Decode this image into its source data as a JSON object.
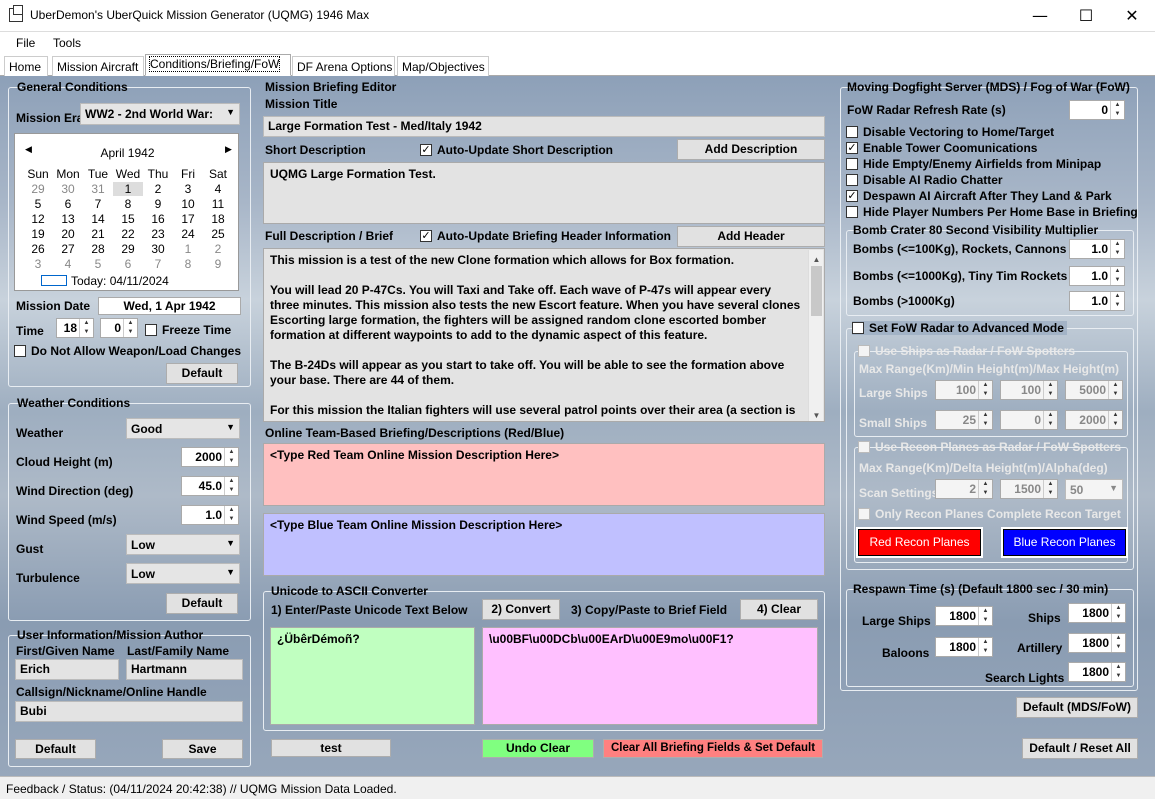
{
  "window": {
    "title": "UberDemon's UberQuick Mission Generator (UQMG) 1946 Max",
    "minimize": "—",
    "maximize": "☐",
    "close": "✕"
  },
  "menu": [
    "File",
    "Tools"
  ],
  "tabs": [
    "Home",
    "Mission Aircraft",
    "Conditions/Briefing/FoW",
    "DF Arena Options",
    "Map/Objectives"
  ],
  "general": {
    "title": "General Conditions",
    "era_label": "Mission Era",
    "era_value": "WW2 - 2nd World War:",
    "calendar": {
      "month": "April 1942",
      "days": [
        "Sun",
        "Mon",
        "Tue",
        "Wed",
        "Thu",
        "Fri",
        "Sat"
      ],
      "weeks": [
        [
          "29",
          "30",
          "31",
          "1",
          "2",
          "3",
          "4"
        ],
        [
          "5",
          "6",
          "7",
          "8",
          "9",
          "10",
          "11"
        ],
        [
          "12",
          "13",
          "14",
          "15",
          "16",
          "17",
          "18"
        ],
        [
          "19",
          "20",
          "21",
          "22",
          "23",
          "24",
          "25"
        ],
        [
          "26",
          "27",
          "28",
          "29",
          "30",
          "1",
          "2"
        ],
        [
          "3",
          "4",
          "5",
          "6",
          "7",
          "8",
          "9"
        ]
      ],
      "today": "Today: 04/11/2024"
    },
    "date_label": "Mission Date",
    "date_value": "Wed, 1 Apr 1942",
    "time_label": "Time",
    "hour": "18",
    "minute": "0",
    "freeze": "Freeze Time",
    "noweapon": "Do Not Allow Weapon/Load Changes",
    "default_btn": "Default"
  },
  "weather": {
    "title": "Weather Conditions",
    "weather_label": "Weather",
    "weather_value": "Good",
    "cloud_label": "Cloud Height (m)",
    "cloud_value": "2000",
    "wdir_label": "Wind Direction (deg)",
    "wdir_value": "45.0",
    "wspd_label": "Wind Speed (m/s)",
    "wspd_value": "1.0",
    "gust_label": "Gust",
    "gust_value": "Low",
    "turb_label": "Turbulence",
    "turb_value": "Low",
    "default_btn": "Default"
  },
  "user": {
    "title": "User Information/Mission Author",
    "first_label": "First/Given Name",
    "first_value": "Erich",
    "last_label": "Last/Family Name",
    "last_value": "Hartmann",
    "callsign_label": "Callsign/Nickname/Online Handle",
    "callsign_value": "Bubi",
    "default_btn": "Default",
    "save_btn": "Save"
  },
  "briefing": {
    "title": "Mission Briefing Editor",
    "mission_title_label": "Mission Title",
    "mission_title": "Large Formation Test - Med/Italy 1942",
    "short_label": "Short Description",
    "short_auto": "Auto-Update Short Description",
    "add_desc": "Add Description",
    "short_text": "UQMG Large Formation Test.",
    "full_label": "Full Description / Brief",
    "full_auto": "Auto-Update Briefing Header Information",
    "add_header": "Add Header",
    "full_p1": "This mission is a test of the new Clone formation which allows for Box formation.",
    "full_p2": "You will lead 20 P-47Cs.  You will Taxi and Take off.  Each wave of P-47s will appear every three minutes.  This mission also tests the new Escort feature.  When you have several clones Escorting large formation, the fighters will be assigned random clone escorted bomber formation at different waypoints to add to the dynamic aspect of this feature.",
    "full_p3": "The B-24Ds will appear as you start to take off.  You will be able to see the formation above your base.  There are 44 of them.",
    "full_p4": "For this mission the Italian fighters will use several patrol points over their area (a section is",
    "online_label": "Online Team-Based Briefing/Descriptions (Red/Blue)",
    "red_text": "<Type Red Team Online Mission Description Here>",
    "blue_text": "<Type Blue Team Online Mission Description Here>"
  },
  "unicode": {
    "title": "Unicode to ASCII Converter",
    "step1": "1) Enter/Paste Unicode Text Below",
    "convert_btn": "2) Convert",
    "step3": "3) Copy/Paste to Brief Field",
    "clear_btn": "4) Clear",
    "input": "¿ÜbêrDémoñ?",
    "output": "\\u00BF\\u00DCb\\u00EArD\\u00E9mo\\u00F1?"
  },
  "bottom": {
    "test_btn": "test",
    "undo_btn": "Undo Clear",
    "clearall_btn": "Clear All Briefing Fields & Set Default"
  },
  "mds": {
    "title": "Moving Dogfight Server (MDS) / Fog of War (FoW)",
    "radar_label": "FoW Radar Refresh Rate (s)",
    "radar_value": "0",
    "checks": [
      {
        "label": "Disable Vectoring to Home/Target",
        "checked": ""
      },
      {
        "label": "Enable Tower Coomunications",
        "checked": "✓"
      },
      {
        "label": "Hide Empty/Enemy Airfields from Minipap",
        "checked": ""
      },
      {
        "label": "Disable AI Radio Chatter",
        "checked": ""
      },
      {
        "label": "Despawn AI Aircraft After They Land & Park",
        "checked": "✓"
      },
      {
        "label": "Hide Player Numbers Per Home Base in Briefing",
        "checked": ""
      }
    ],
    "crater_title": "Bomb Crater 80 Second Visibility Multiplier",
    "bombs1_label": "Bombs (<=100Kg), Rockets, Cannons",
    "bombs1": "1.0",
    "bombs2_label": "Bombs (<=1000Kg), Tiny Tim Rockets",
    "bombs2": "1.0",
    "bombs3_label": "Bombs (>1000Kg)",
    "bombs3": "1.0",
    "adv_label": "Set FoW Radar to Advanced Mode",
    "ships_radar": "Use Ships as Radar / FoW Spotters",
    "maxrange1": "Max Range(Km)/Min Height(m)/Max Height(m)",
    "large_ships": "Large Ships",
    "ls1": "100",
    "ls2": "100",
    "ls3": "5000",
    "small_ships": "Small Ships",
    "ss1": "25",
    "ss2": "0",
    "ss3": "2000",
    "recon_radar": "Use Recon Planes as Radar / FoW Spotters",
    "maxrange2": "Max Range(Km)/Delta Height(m)/Alpha(deg)",
    "scan_label": "Scan Settings",
    "sc1": "2",
    "sc2": "1500",
    "sc3": "50",
    "recon_only": "Only Recon Planes Complete Recon Target",
    "red_recon": "Red Recon Planes",
    "blue_recon": "Blue Recon Planes",
    "respawn_title": "Respawn Time (s) (Default 1800 sec / 30 min)",
    "rs_large": "Large Ships",
    "rs_large_v": "1800",
    "rs_ships": "Ships",
    "rs_ships_v": "1800",
    "rs_balloons": "Baloons",
    "rs_balloons_v": "1800",
    "rs_art": "Artillery",
    "rs_art_v": "1800",
    "rs_lights": "Search Lights",
    "rs_lights_v": "1800",
    "default_btn": "Default (MDS/FoW)",
    "reset_btn": "Default / Reset All"
  },
  "status": "Feedback / Status:  (04/11/2024 20:42:38) // UQMG Mission Data Loaded."
}
